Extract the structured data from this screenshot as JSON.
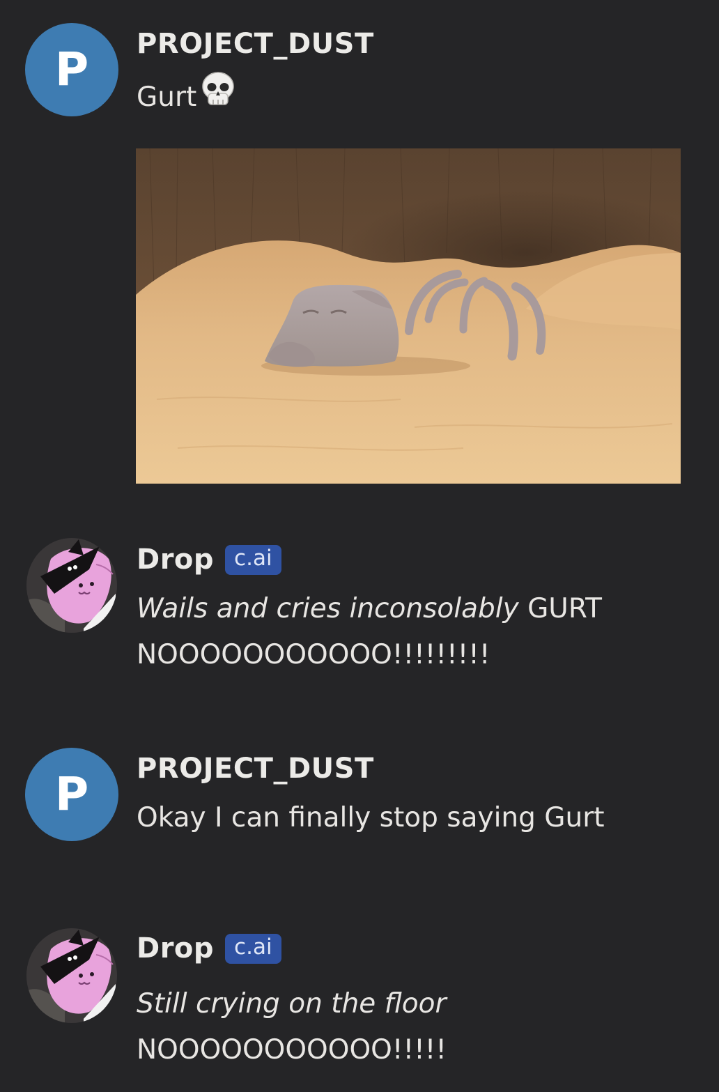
{
  "messages": [
    {
      "author": "PROJECT_DUST",
      "avatar_letter": "P",
      "avatar_color": "#3e7cb2",
      "text": "Gurt",
      "emoji": "skull-emoji",
      "attachment": {
        "type": "image",
        "subject": "gray-rock-creature-in-sand-cave"
      }
    },
    {
      "author": "Drop",
      "badge": "c.ai",
      "badge_color": "#2f52a3",
      "avatar": "pink-cat-character-avatar",
      "italic_text": "Wails and cries inconsolably",
      "line1_rest": "GURT",
      "line2": "NOOOOOOOOOOO!!!!!!!!!"
    },
    {
      "author": "PROJECT_DUST",
      "avatar_letter": "P",
      "avatar_color": "#3e7cb2",
      "text": "Okay I can finally stop saying Gurt"
    },
    {
      "author": "Drop",
      "badge": "c.ai",
      "badge_color": "#2f52a3",
      "avatar": "pink-cat-character-avatar",
      "italic_text": "Still crying on the floor",
      "line2": "NOOOOOOOOOOO!!!!!"
    }
  ],
  "colors": {
    "background": "#252527",
    "text": "#e8e6e3"
  }
}
